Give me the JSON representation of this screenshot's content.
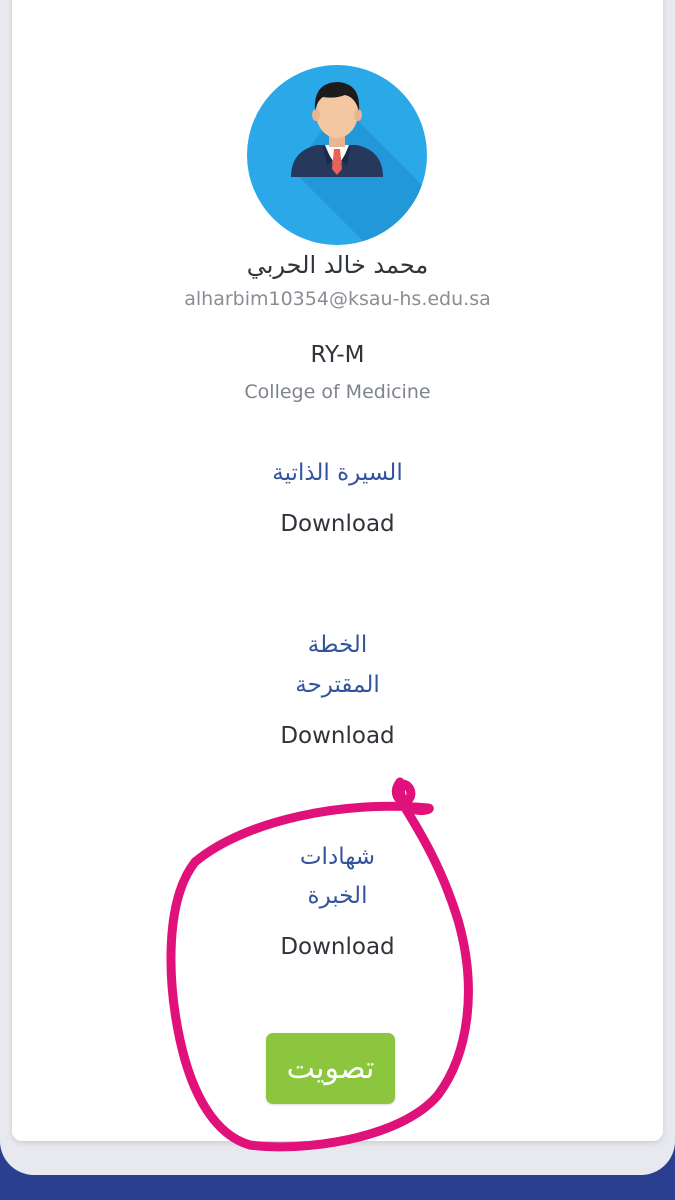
{
  "profile": {
    "name": "محمد خالد الحربي",
    "email": "alharbim10354@ksau-hs.edu.sa",
    "code": "RY-M",
    "college": "College of Medicine"
  },
  "sections": {
    "cv": {
      "title": "السيرة الذاتية",
      "download_label": "Download"
    },
    "plan": {
      "title_line1": "الخطة",
      "title_line2": "المقترحة",
      "download_label": "Download"
    },
    "experience": {
      "title_line1": "شهادات",
      "title_line2": "الخبرة",
      "download_label": "Download"
    }
  },
  "actions": {
    "vote_label": "تصويت"
  },
  "colors": {
    "accent_blue": "#33549c",
    "vote_green": "#8cc63e",
    "avatar_bg": "#2aa8e8",
    "annotation_pink": "#e0117a",
    "page_bottom_blue": "#2a3f8f"
  },
  "icons": {
    "avatar": "user-avatar-icon"
  }
}
